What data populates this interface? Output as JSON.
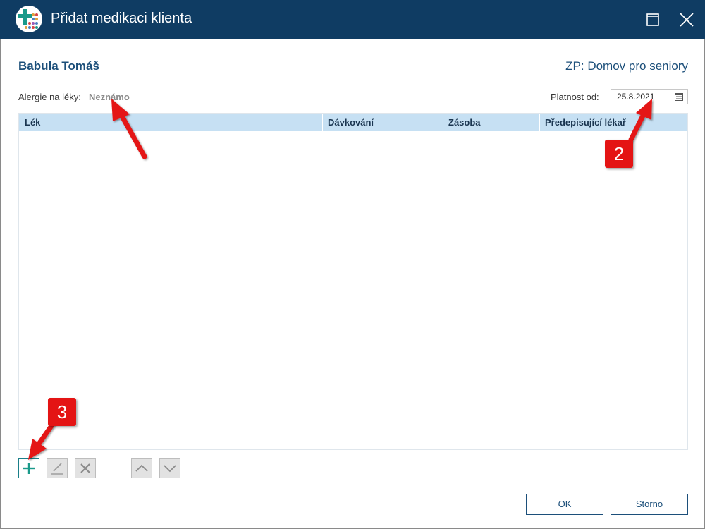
{
  "window": {
    "title": "Přidat medikaci klienta"
  },
  "client": {
    "name": "Babula Tomáš",
    "facility": "ZP: Domov pro seniory",
    "allergy_label": "Alergie na léky:",
    "allergy_value": "Neznámo"
  },
  "validity": {
    "label": "Platnost od:",
    "date": "25.8.2021"
  },
  "grid": {
    "columns": [
      "Lék",
      "Dávkování",
      "Zásoba",
      "Předepisující lékař"
    ],
    "rows": []
  },
  "toolbar": {
    "add": "add-icon",
    "edit": "edit-icon",
    "delete": "delete-icon",
    "move_up": "chevron-up-icon",
    "move_down": "chevron-down-icon"
  },
  "buttons": {
    "ok": "OK",
    "cancel": "Storno"
  },
  "callouts": {
    "two": "2",
    "three": "3"
  },
  "colors": {
    "titlebar": "#0f3c63",
    "accent": "#1c4f7a",
    "grid_header": "#c6e0f3",
    "callout": "#e41414",
    "add_button": "#1a7f89"
  }
}
